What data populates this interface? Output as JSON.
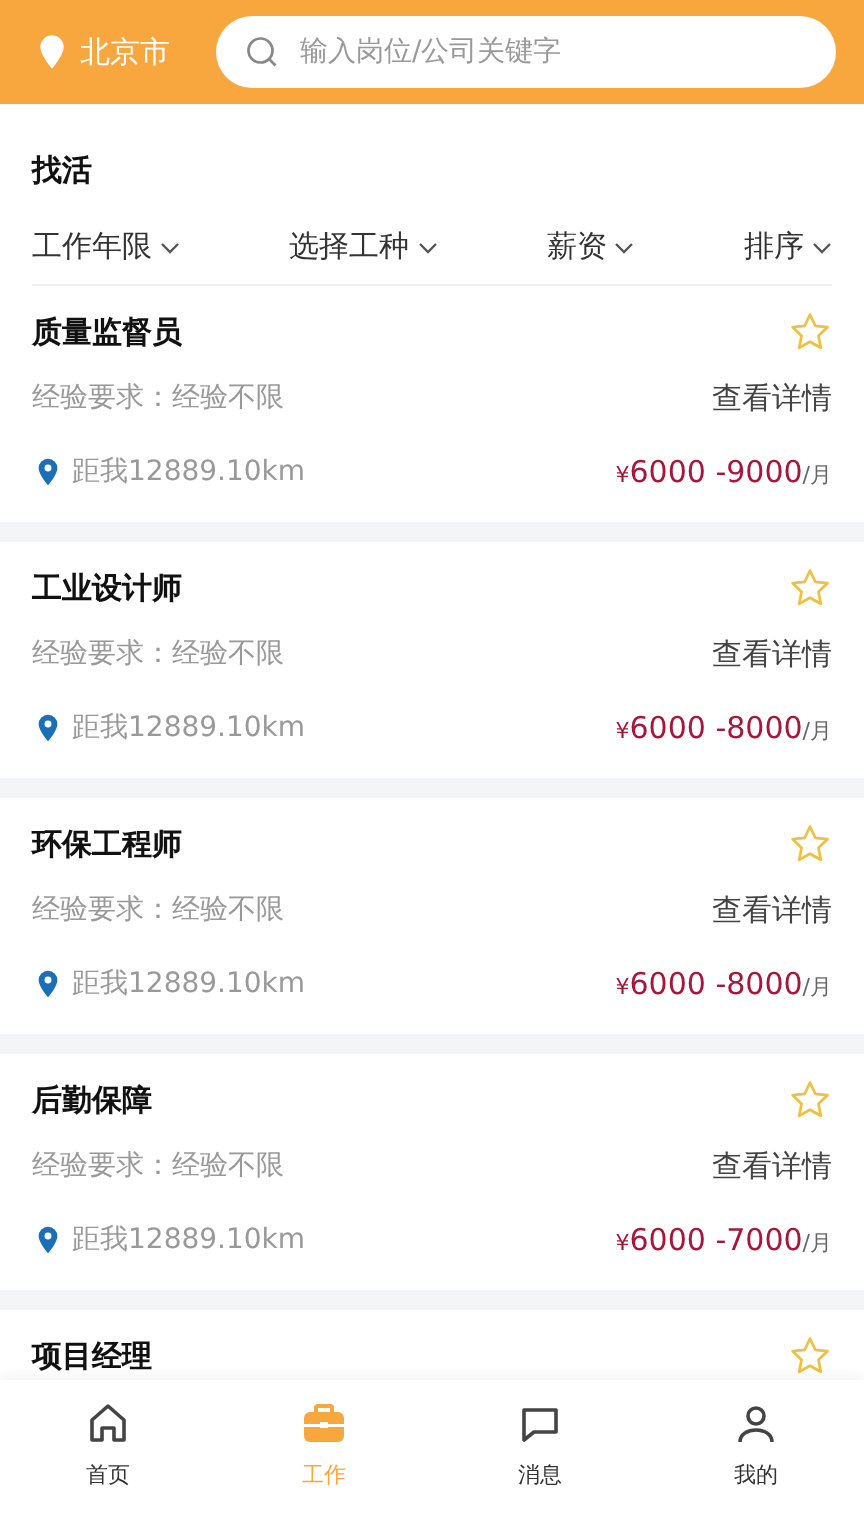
{
  "header": {
    "city": "北京市",
    "search": {
      "placeholder": "输入岗位/公司关键字"
    }
  },
  "section_title": "找活",
  "filters": [
    {
      "label": "工作年限"
    },
    {
      "label": "选择工种"
    },
    {
      "label": "薪资"
    },
    {
      "label": "排序"
    }
  ],
  "jobs": [
    {
      "title": "质量监督员",
      "favorited": false,
      "experience": "经验要求：经验不限",
      "details_link": "查看详情",
      "distance": "距我12889.10km",
      "currency": "¥",
      "salary": "6000 -9000",
      "unit": "/月"
    },
    {
      "title": "工业设计师",
      "favorited": false,
      "experience": "经验要求：经验不限",
      "details_link": "查看详情",
      "distance": "距我12889.10km",
      "currency": "¥",
      "salary": "6000 -8000",
      "unit": "/月"
    },
    {
      "title": "环保工程师",
      "favorited": false,
      "experience": "经验要求：经验不限",
      "details_link": "查看详情",
      "distance": "距我12889.10km",
      "currency": "¥",
      "salary": "6000 -8000",
      "unit": "/月"
    },
    {
      "title": "后勤保障",
      "favorited": false,
      "experience": "经验要求：经验不限",
      "details_link": "查看详情",
      "distance": "距我12889.10km",
      "currency": "¥",
      "salary": "6000 -7000",
      "unit": "/月"
    },
    {
      "title": "项目经理",
      "favorited": false
    }
  ],
  "tab_bar": [
    {
      "label": "首页",
      "kind": "home",
      "selected": false
    },
    {
      "label": "工作",
      "kind": "work",
      "selected": true
    },
    {
      "label": "消息",
      "kind": "message",
      "selected": false
    },
    {
      "label": "我的",
      "kind": "profile",
      "selected": false
    }
  ]
}
